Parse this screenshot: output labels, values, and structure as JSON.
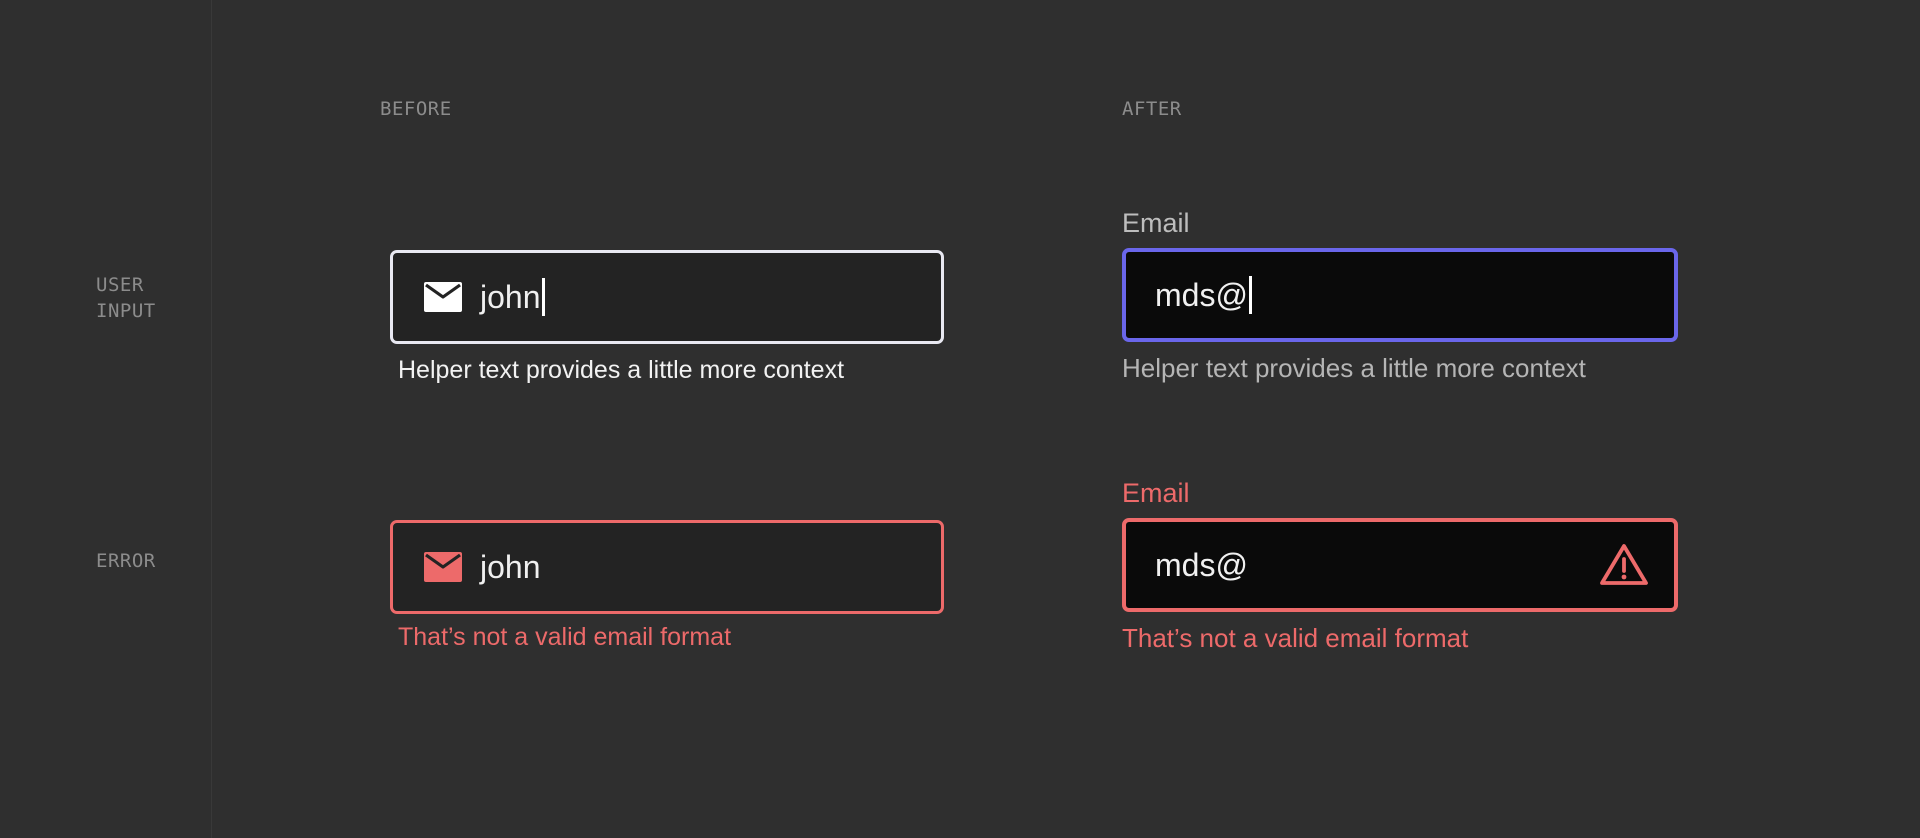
{
  "columns": {
    "before": "BEFORE",
    "after": "AFTER"
  },
  "rows": {
    "user_input": [
      "USER",
      "INPUT"
    ],
    "error": "ERROR"
  },
  "before": {
    "user_input": {
      "value": "john",
      "helper": "Helper text provides a little more context",
      "icon": "mail-icon"
    },
    "error": {
      "value": "john",
      "helper": "That’s not a valid email format",
      "icon": "mail-icon"
    }
  },
  "after": {
    "user_input": {
      "label": "Email",
      "value": "mds@",
      "helper": "Helper text provides a little more context"
    },
    "error": {
      "label": "Email",
      "value": "mds@",
      "helper": "That’s not a valid email format",
      "icon": "warning-icon"
    }
  },
  "colors": {
    "background": "#2f2f2f",
    "focus_border": "#6a66ea",
    "error": "#ed6a6a",
    "before_focus_border": "#e9e9f2"
  }
}
